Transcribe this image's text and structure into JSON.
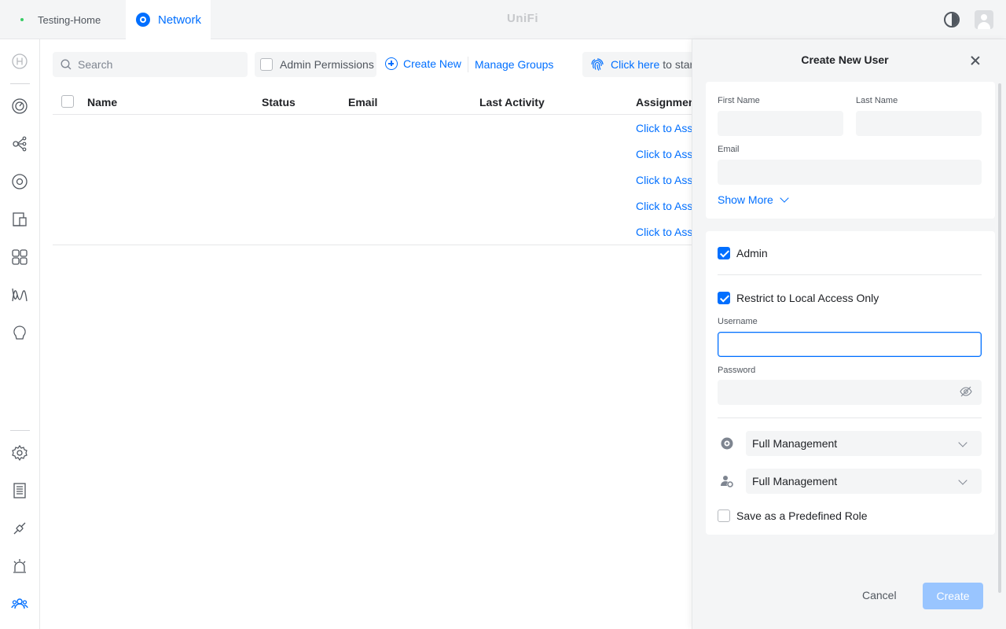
{
  "topbar": {
    "site_name": "Testing-Home",
    "app_tab": "Network",
    "logo": "UniFi"
  },
  "sidebar": {
    "items": [
      {
        "icon": "home-h-icon"
      },
      {
        "icon": "dashboard-icon"
      },
      {
        "icon": "topology-icon"
      },
      {
        "icon": "devices-icon"
      },
      {
        "icon": "client-devices-icon"
      },
      {
        "icon": "ports-icon"
      },
      {
        "icon": "insights-icon"
      },
      {
        "icon": "innerspace-icon"
      },
      {
        "icon": "settings-icon"
      },
      {
        "icon": "logs-icon"
      },
      {
        "icon": "integrations-icon"
      },
      {
        "icon": "alarms-icon"
      },
      {
        "icon": "admins-users-icon"
      }
    ]
  },
  "toolbar": {
    "search_placeholder": "Search",
    "admin_permissions": "Admin Permissions",
    "create_new": "Create New",
    "manage_groups": "Manage Groups",
    "hint_link": "Click here",
    "hint_rest": "to start"
  },
  "table": {
    "columns": [
      "Name",
      "Status",
      "Email",
      "Last Activity",
      "Assignments"
    ],
    "rows": [
      {
        "assignment": "Click to Assign"
      },
      {
        "assignment": "Click to Assign"
      },
      {
        "assignment": "Click to Assign"
      },
      {
        "assignment": "Click to Assign"
      },
      {
        "assignment": "Click to Assign"
      }
    ]
  },
  "drawer": {
    "title": "Create New User",
    "first_name_label": "First Name",
    "last_name_label": "Last Name",
    "email_label": "Email",
    "show_more": "Show More",
    "admin_label": "Admin",
    "admin_checked": true,
    "restrict_label": "Restrict to Local Access Only",
    "restrict_checked": true,
    "username_label": "Username",
    "password_label": "Password",
    "network_role": "Full Management",
    "user_role": "Full Management",
    "predefined_label": "Save as a Predefined Role",
    "predefined_checked": false,
    "cancel": "Cancel",
    "create": "Create"
  },
  "colors": {
    "accent": "#006fff",
    "disabled_button": "#99c5ff",
    "online_dot": "#38cc65"
  }
}
